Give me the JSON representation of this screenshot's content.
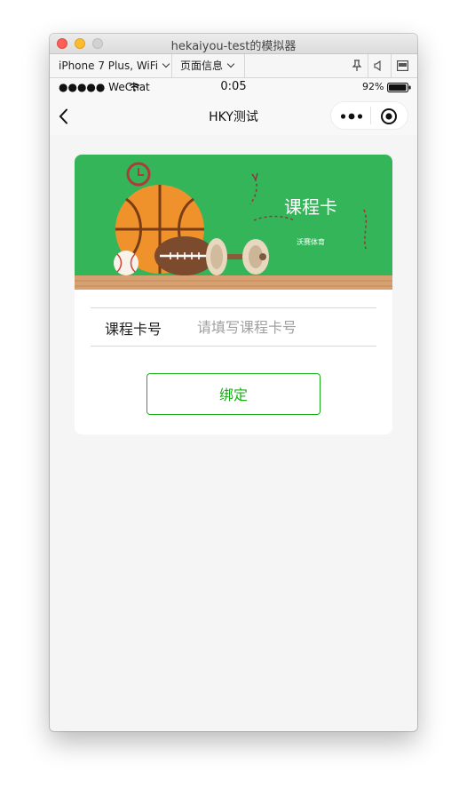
{
  "window": {
    "title": "hekaiyou-test的模拟器"
  },
  "toolbar": {
    "device": "iPhone 7 Plus, WiFi",
    "page_info": "页面信息"
  },
  "status_bar": {
    "carrier": "●●●●● WeChat",
    "time": "0:05",
    "battery": "92%"
  },
  "nav": {
    "title": "HKY测试"
  },
  "banner": {
    "title": "课程卡",
    "subtitle": "沃赛体育"
  },
  "form": {
    "card_label": "课程卡号",
    "card_placeholder": "请填写课程卡号",
    "card_value": "",
    "submit_label": "绑定"
  },
  "colors": {
    "accent": "#1aad19",
    "banner_green": "#34b55a",
    "floor": "#d7a070"
  }
}
